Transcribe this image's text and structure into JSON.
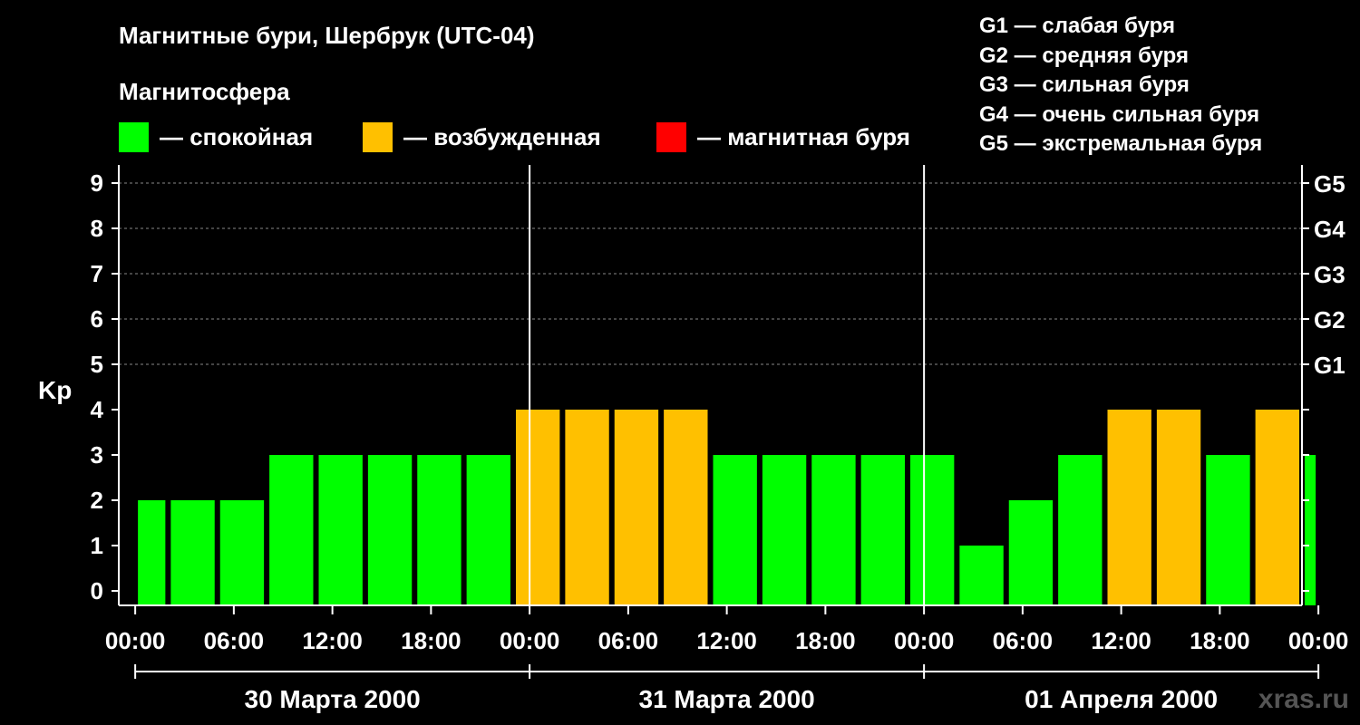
{
  "title": "Магнитные бури, Шербрук (UTC-04)",
  "magnetosphere_label": "Магнитосфера",
  "legend": [
    {
      "color": "#00ff00",
      "label": "— спокойная"
    },
    {
      "color": "#ffc000",
      "label": "— возбужденная"
    },
    {
      "color": "#ff0000",
      "label": "— магнитная буря"
    }
  ],
  "g_scale": [
    "G1 — слабая буря",
    "G2 — средняя буря",
    "G3 — сильная буря",
    "G4 — очень сильная буря",
    "G5 — экстремальная буря"
  ],
  "watermark": "xras.ru",
  "chart_data": {
    "type": "bar",
    "ylabel": "Kp",
    "ylim": [
      0,
      9
    ],
    "yticks": [
      0,
      1,
      2,
      3,
      4,
      5,
      6,
      7,
      8,
      9
    ],
    "right_axis_labels": [
      {
        "kp": 5,
        "label": "G1"
      },
      {
        "kp": 6,
        "label": "G2"
      },
      {
        "kp": 7,
        "label": "G3"
      },
      {
        "kp": 8,
        "label": "G4"
      },
      {
        "kp": 9,
        "label": "G5"
      }
    ],
    "xlim_hours": [
      -1,
      71
    ],
    "xtick_labels": [
      "00:00",
      "06:00",
      "12:00",
      "18:00",
      "00:00",
      "06:00",
      "12:00",
      "18:00",
      "00:00",
      "06:00",
      "12:00",
      "18:00",
      "00:00"
    ],
    "day_labels": [
      "30 Марта 2000",
      "31 Марта 2000",
      "01 Апреля 2000"
    ],
    "bars": [
      {
        "start": "2000-03-30 00:00",
        "end": "2000-03-30 02:00",
        "kp": 2
      },
      {
        "start": "2000-03-30 02:00",
        "end": "2000-03-30 05:00",
        "kp": 2
      },
      {
        "start": "2000-03-30 05:00",
        "end": "2000-03-30 08:00",
        "kp": 2
      },
      {
        "start": "2000-03-30 08:00",
        "end": "2000-03-30 11:00",
        "kp": 3
      },
      {
        "start": "2000-03-30 11:00",
        "end": "2000-03-30 14:00",
        "kp": 3
      },
      {
        "start": "2000-03-30 14:00",
        "end": "2000-03-30 17:00",
        "kp": 3
      },
      {
        "start": "2000-03-30 17:00",
        "end": "2000-03-30 20:00",
        "kp": 3
      },
      {
        "start": "2000-03-30 20:00",
        "end": "2000-03-30 23:00",
        "kp": 3
      },
      {
        "start": "2000-03-30 23:00",
        "end": "2000-03-31 02:00",
        "kp": 4
      },
      {
        "start": "2000-03-31 02:00",
        "end": "2000-03-31 05:00",
        "kp": 4
      },
      {
        "start": "2000-03-31 05:00",
        "end": "2000-03-31 08:00",
        "kp": 4
      },
      {
        "start": "2000-03-31 08:00",
        "end": "2000-03-31 11:00",
        "kp": 4
      },
      {
        "start": "2000-03-31 11:00",
        "end": "2000-03-31 14:00",
        "kp": 3
      },
      {
        "start": "2000-03-31 14:00",
        "end": "2000-03-31 17:00",
        "kp": 3
      },
      {
        "start": "2000-03-31 17:00",
        "end": "2000-03-31 20:00",
        "kp": 3
      },
      {
        "start": "2000-03-31 20:00",
        "end": "2000-03-31 23:00",
        "kp": 3
      },
      {
        "start": "2000-03-31 23:00",
        "end": "2000-04-01 02:00",
        "kp": 3
      },
      {
        "start": "2000-04-01 02:00",
        "end": "2000-04-01 05:00",
        "kp": 1
      },
      {
        "start": "2000-04-01 05:00",
        "end": "2000-04-01 08:00",
        "kp": 2
      },
      {
        "start": "2000-04-01 08:00",
        "end": "2000-04-01 11:00",
        "kp": 3
      },
      {
        "start": "2000-04-01 11:00",
        "end": "2000-04-01 14:00",
        "kp": 4
      },
      {
        "start": "2000-04-01 14:00",
        "end": "2000-04-01 17:00",
        "kp": 4
      },
      {
        "start": "2000-04-01 17:00",
        "end": "2000-04-01 20:00",
        "kp": 3
      },
      {
        "start": "2000-04-01 20:00",
        "end": "2000-04-01 23:00",
        "kp": 4
      },
      {
        "start": "2000-04-01 23:00",
        "end": "2000-04-02 00:00",
        "kp": 3
      }
    ],
    "colors": {
      "quiet": "#00ff00",
      "active": "#ffc000",
      "storm": "#ff0000"
    },
    "grid": "dashed horizontal"
  }
}
